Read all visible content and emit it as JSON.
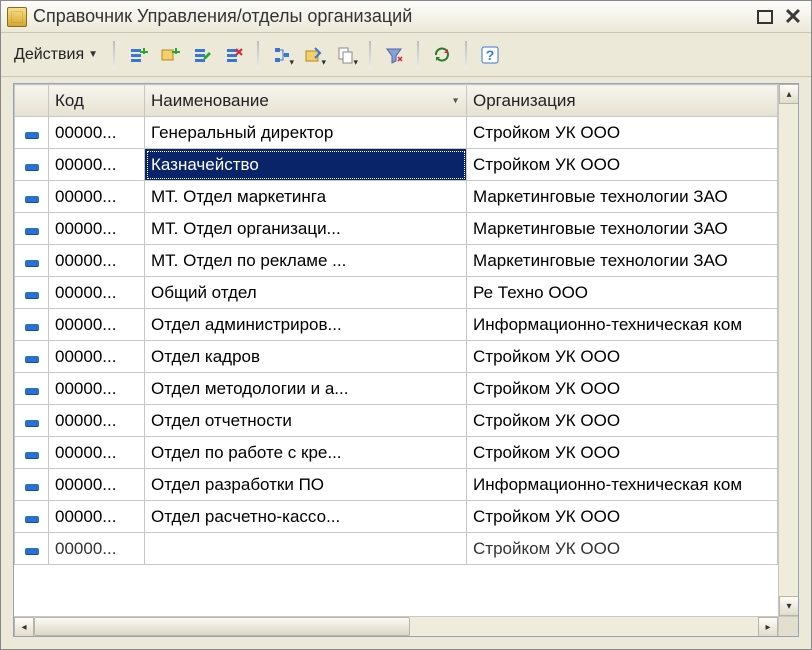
{
  "window": {
    "title": "Справочник Управления/отделы организаций"
  },
  "toolbar": {
    "actions_label": "Действия"
  },
  "grid": {
    "columns": {
      "code": "Код",
      "name": "Наименование",
      "org": "Организация"
    },
    "rows": [
      {
        "code": "00000...",
        "name": "Генеральный директор",
        "org": "Стройком УК ООО",
        "selected": false
      },
      {
        "code": "00000...",
        "name": "Казначейство",
        "org": "Стройком УК ООО",
        "selected": true
      },
      {
        "code": "00000...",
        "name": "МТ. Отдел маркетинга",
        "org": "Маркетинговые технологии ЗАО"
      },
      {
        "code": "00000...",
        "name": "МТ. Отдел организаци...",
        "org": "Маркетинговые технологии ЗАО"
      },
      {
        "code": "00000...",
        "name": "МТ. Отдел по рекламе ...",
        "org": "Маркетинговые технологии ЗАО"
      },
      {
        "code": "00000...",
        "name": "Общий отдел",
        "org": "Ре Техно ООО"
      },
      {
        "code": "00000...",
        "name": "Отдел администриров...",
        "org": "Информационно-техническая ком"
      },
      {
        "code": "00000...",
        "name": "Отдел кадров",
        "org": "Стройком УК ООО"
      },
      {
        "code": "00000...",
        "name": "Отдел методологии и а...",
        "org": "Стройком УК ООО"
      },
      {
        "code": "00000...",
        "name": "Отдел отчетности",
        "org": "Стройком УК ООО"
      },
      {
        "code": "00000...",
        "name": "Отдел по работе с кре...",
        "org": "Стройком УК ООО"
      },
      {
        "code": "00000...",
        "name": "Отдел разработки ПО",
        "org": "Информационно-техническая ком"
      },
      {
        "code": "00000...",
        "name": "Отдел расчетно-кассо...",
        "org": "Стройком УК ООО"
      },
      {
        "code": "00000...",
        "name": "",
        "org": "Стройком УК ООО"
      }
    ]
  }
}
